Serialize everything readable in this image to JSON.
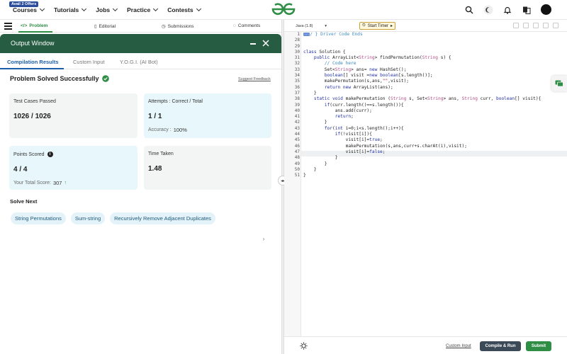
{
  "nav": {
    "offer_badge": "Avail 2 Offers",
    "links": [
      "Courses",
      "Tutorials",
      "Jobs",
      "Practice",
      "Contests"
    ]
  },
  "left_tabs": {
    "problem": "Problem",
    "editorial": "Editorial",
    "submissions": "Submissions",
    "comments": "Comments"
  },
  "output": {
    "title": "Output Window",
    "tabs": [
      "Compilation Results",
      "Custom Input",
      "Y.O.G.I. (AI Bot)"
    ],
    "solved_text": "Problem Solved Successfully",
    "feedback": "Suggest Feedback",
    "cards": {
      "test_cases_label": "Test Cases Passed",
      "test_cases_value": "1026 / 1026",
      "attempts_label": "Attempts : Correct / Total",
      "attempts_value": "1 / 1",
      "accuracy_label": "Accuracy :",
      "accuracy_value": "100%",
      "points_label": "Points Scored",
      "points_value": "4 / 4",
      "total_score_label": "Your Total Score:",
      "total_score_value": "307",
      "time_label": "Time Taken",
      "time_value": "1.48"
    },
    "solve_next_label": "Solve Next",
    "solve_next": [
      "String Permutations",
      "Sum-string",
      "Recursively Remove Adjacent Duplicates"
    ]
  },
  "editor": {
    "language": "Java (1.8)",
    "timer_label": "Start Timer",
    "line_numbers": [
      "1",
      "28",
      "29",
      "30",
      "31",
      "32",
      "33",
      "34",
      "35",
      "36",
      "37",
      "38",
      "39",
      "40",
      "41",
      "42",
      "43",
      "44",
      "45",
      "46",
      "47",
      "48",
      "49",
      "50",
      "51"
    ],
    "custom_input": "Custom Input",
    "compile_run": "Compile & Run",
    "submit": "Submit"
  },
  "colors": {
    "brand_green": "#2f8d46",
    "output_header": "#265c42",
    "link_blue": "#1b5ea8"
  }
}
